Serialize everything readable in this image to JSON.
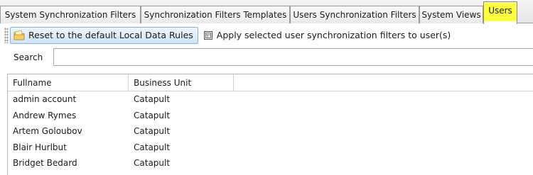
{
  "tabs": [
    {
      "label": "System Synchronization Filters",
      "active": false
    },
    {
      "label": "Synchronization Filters Templates",
      "active": false
    },
    {
      "label": "Users Synchronization Filters",
      "active": false
    },
    {
      "label": "System Views",
      "active": false
    },
    {
      "label": "Users",
      "active": true
    }
  ],
  "colors": {
    "active_tab_highlight": "#ffff3b",
    "hot_button_border": "#7fb4e6"
  },
  "toolbar": {
    "reset_label": "Reset to the default Local Data Rules",
    "reset_icon": "folder-note-icon",
    "apply_label": "Apply selected user synchronization filters to user(s)",
    "apply_icon": "apply-filter-icon"
  },
  "search": {
    "label": "Search",
    "value": ""
  },
  "grid": {
    "columns": [
      "Fullname",
      "Business Unit",
      ""
    ],
    "rows": [
      [
        "admin account",
        "Catapult"
      ],
      [
        "Andrew Rymes",
        "Catapult"
      ],
      [
        "Artem Goloubov",
        "Catapult"
      ],
      [
        "Blair Hurlbut",
        "Catapult"
      ],
      [
        "Bridget Bedard",
        "Catapult"
      ]
    ]
  }
}
